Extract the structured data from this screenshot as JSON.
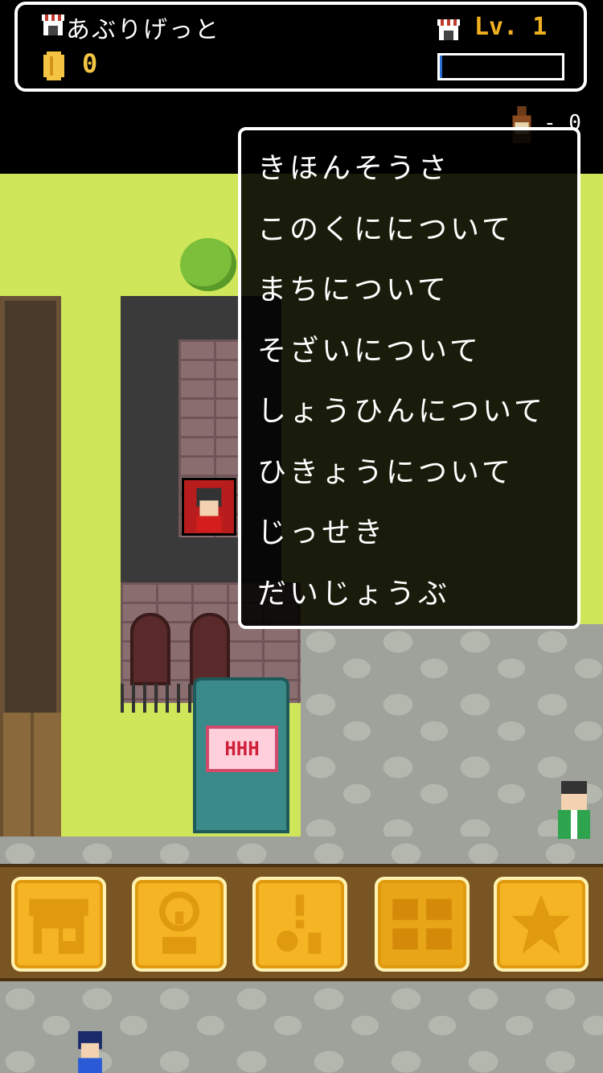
{
  "status": {
    "shop_name": "あぶりげっと",
    "coins": "0",
    "level": "Lv. 1",
    "xp_fraction": 0.02,
    "bottles": "- 0"
  },
  "world": {
    "arcade_screen_text": "HHH"
  },
  "menu": {
    "items": [
      "きほんそうさ",
      "このくにについて",
      "まちについて",
      "そざいについて",
      "しょうひんについて",
      "ひきょうについて",
      "じっせき",
      "だいじょうぶ"
    ]
  },
  "toolbar": {
    "buttons": [
      {
        "icon": "shop-icon"
      },
      {
        "icon": "question-recipe-icon"
      },
      {
        "icon": "event-person-icon"
      },
      {
        "icon": "town-map-icon"
      },
      {
        "icon": "star-icon"
      }
    ]
  },
  "colors": {
    "grass": "#cfe65a",
    "button": "#f5b424",
    "level_text": "#f0b020",
    "coin": "#f4c542",
    "xp_bar": "#2a6fd6"
  }
}
